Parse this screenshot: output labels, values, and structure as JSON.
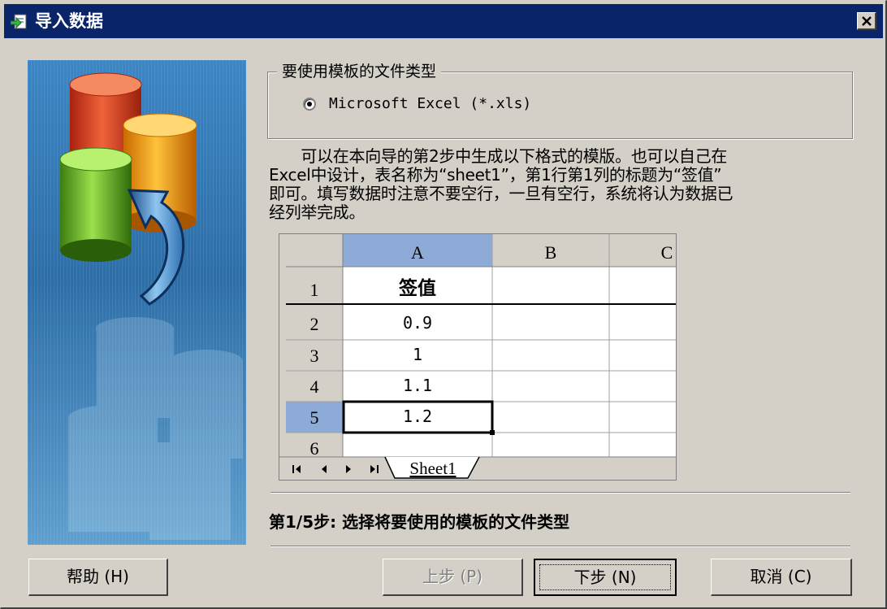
{
  "window": {
    "title": "导入数据"
  },
  "group": {
    "legend": "要使用模板的文件类型",
    "option_label": "Microsoft Excel (*.xls)",
    "option_selected": true
  },
  "description": [
    "　　可以在本向导的第2步中生成以下格式的模版。也可以自己在",
    "Excel中设计，表名称为“sheet1”，第1行第1列的标题为“签值”",
    "即可。填写数据时注意不要空行，一旦有空行，系统将认为数据已",
    "经列举完成。"
  ],
  "spreadsheet": {
    "columns": [
      "A",
      "B",
      "C"
    ],
    "row_numbers": [
      "1",
      "2",
      "3",
      "4",
      "5",
      "6"
    ],
    "cells_a": [
      "签值",
      "0.9",
      "1",
      "1.1",
      "1.2",
      ""
    ],
    "sheet_tab": "Sheet1",
    "selected_row": 5
  },
  "step_text": "第1/5步: 选择将要使用的模板的文件类型",
  "buttons": {
    "help": "帮助 (H)",
    "prev": "上步 (P)",
    "next": "下步 (N)",
    "cancel": "取消 (C)"
  },
  "icons": [
    "import-data-icon",
    "close-icon",
    "database-cylinders-icon",
    "radio-selected-icon",
    "sheet-nav-first-icon",
    "sheet-nav-prev-icon",
    "sheet-nav-next-icon",
    "sheet-nav-last-icon"
  ],
  "colors": {
    "titlebar": "#0a246a",
    "dialog_bg": "#d4d0c8",
    "banner_bg": "#2a6fa8",
    "selection_header": "#8eaad6"
  }
}
